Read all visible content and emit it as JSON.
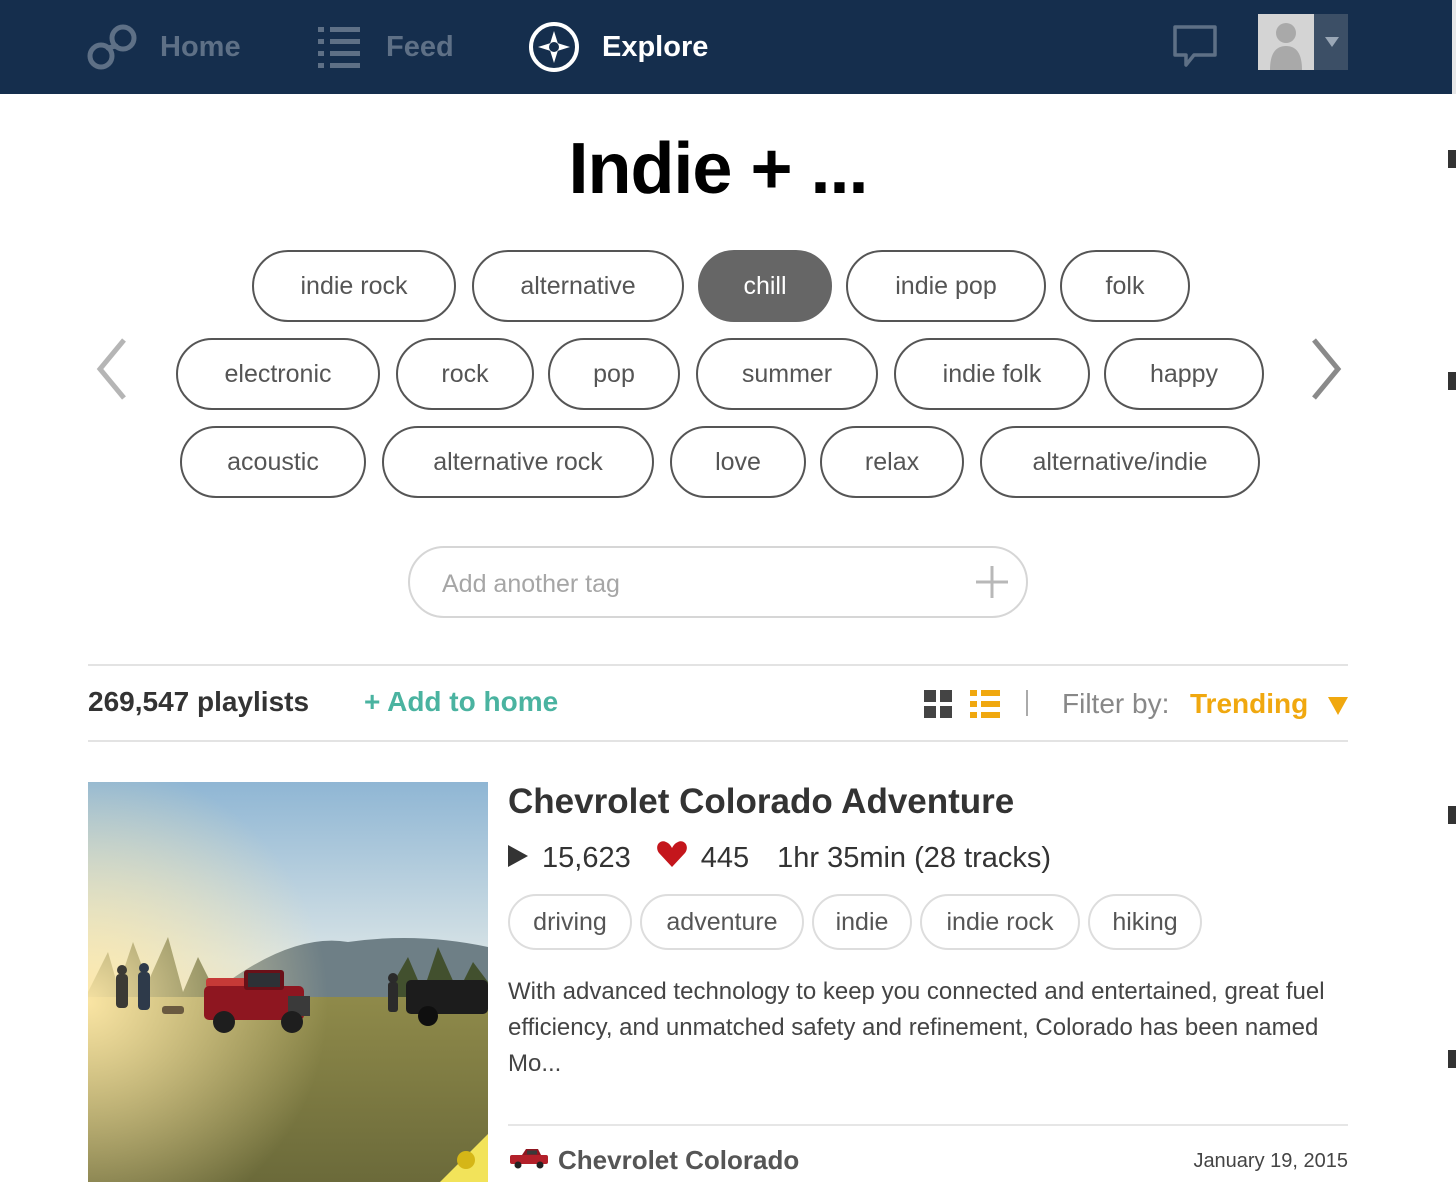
{
  "nav": {
    "home_label": "Home",
    "feed_label": "Feed",
    "explore_label": "Explore",
    "colors": {
      "bar": "#152e4d",
      "inactive": "#5e7086",
      "active": "#ffffff"
    }
  },
  "page": {
    "title": "Indie + ..."
  },
  "tags": {
    "row1": [
      "indie rock",
      "alternative",
      "chill",
      "indie pop",
      "folk"
    ],
    "row2": [
      "electronic",
      "rock",
      "pop",
      "summer",
      "indie folk",
      "happy"
    ],
    "row3": [
      "acoustic",
      "alternative rock",
      "love",
      "relax",
      "alternative/indie"
    ],
    "selected": "chill"
  },
  "add_tag": {
    "placeholder": "Add another tag"
  },
  "results": {
    "count": "269,547 playlists",
    "add_home": "+ Add to home",
    "filter_label": "Filter by:",
    "filter_value": "Trending",
    "accent_teal": "#4ab3a0",
    "accent_orange": "#f0a80f"
  },
  "playlist": {
    "title": "Chevrolet Colorado Adventure",
    "plays": "15,623",
    "likes": "445",
    "duration": "1hr 35min (28 tracks)",
    "tags": [
      "driving",
      "adventure",
      "indie",
      "indie rock",
      "hiking"
    ],
    "description": "With advanced technology to keep you connected and entertained, great fuel efficiency, and unmatched safety and refinement, Colorado has been named Mo...",
    "owner": "Chevrolet Colorado",
    "date": "January 19, 2015",
    "heart_color": "#c4161c"
  }
}
